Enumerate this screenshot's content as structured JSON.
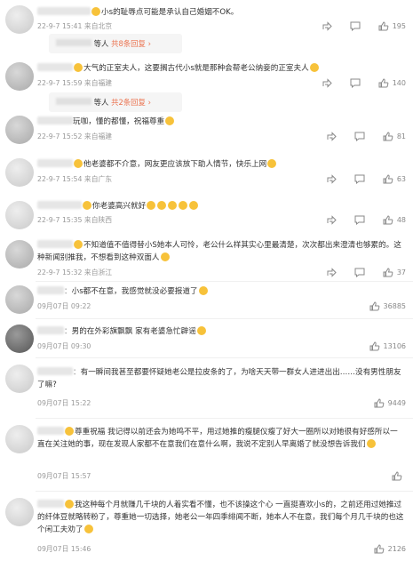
{
  "comments": [
    {
      "text": "小s的耻辱点可能是承认自己婚姻不OK。",
      "time": "22-9-7 15:41",
      "loc": "来自北京",
      "likes": "195",
      "reply": {
        "who": "等人",
        "count": "共8条回复"
      }
    },
    {
      "text": "大气的正室夫人，这要搁古代小s就是那种会帮老公纳妾的正室夫人",
      "time": "22-9-7 15:59",
      "loc": "来自福建",
      "likes": "140",
      "reply": {
        "who": "等人",
        "count": "共2条回复"
      }
    },
    {
      "text": "玩咖，懂的都懂，祝福尊重",
      "time": "22-9-7 15:52",
      "loc": "来自福建",
      "likes": "81"
    },
    {
      "text": "他老婆都不介意，网友更应该放下助人情节，快乐上网",
      "time": "22-9-7 15:54",
      "loc": "来自广东",
      "likes": "63"
    },
    {
      "text": "你老婆高兴就好",
      "time": "22-9-7 15:35",
      "loc": "来自陕西",
      "likes": "48"
    },
    {
      "text": "不知道值不值得替小S她本人可怜，老公什么样其实心里最清楚，次次都出来澄清也够累的。这种新闻别推我，不想看到这种双面人",
      "time": "22-9-7 15:32",
      "loc": "来自浙江",
      "likes": "37"
    },
    {
      "text": "小s都不在意，我感觉就没必要报道了",
      "time": "09月07日 09:22",
      "likes": "36885"
    },
    {
      "text": "男的在外彩旗飘飘 家有老婆急忙辟谣",
      "time": "09月07日 09:30",
      "likes": "13106"
    },
    {
      "text": "有一瞬间我甚至都要怀疑她老公是拉皮条的了，为啥天天带一群女人进进出出……没有男性朋友了嘛?",
      "time": "09月07日 15:22",
      "likes": "9449"
    },
    {
      "text": "尊重祝福 我记得以前还会为她鸣不平，用过她推的瘦腿仪瘦了好大一圈所以对她很有好感所以一直在关注她的事，现在发现人家都不在意我们在意什么啊，我说不定别人早离婚了就没想告诉我们",
      "time": "09月07日 15:57",
      "likes": ""
    },
    {
      "text": "我这种每个月就赚几千块的人着实看不懂，也不该操这个心 一直挺喜欢小s的，之前还用过她推过的纤体豆就略转粉了，尊重她一切选择，她老公一年四季绯闻不断，她本人不在意，我们每个月几千块的也这个闲工夫劝了",
      "time": "09月07日 15:46",
      "likes": "2126"
    }
  ],
  "icons": [
    "share-icon",
    "comment-icon",
    "like-icon"
  ],
  "colors": {
    "reply_accent": "#eb7350",
    "badge": "#f7a21b"
  }
}
